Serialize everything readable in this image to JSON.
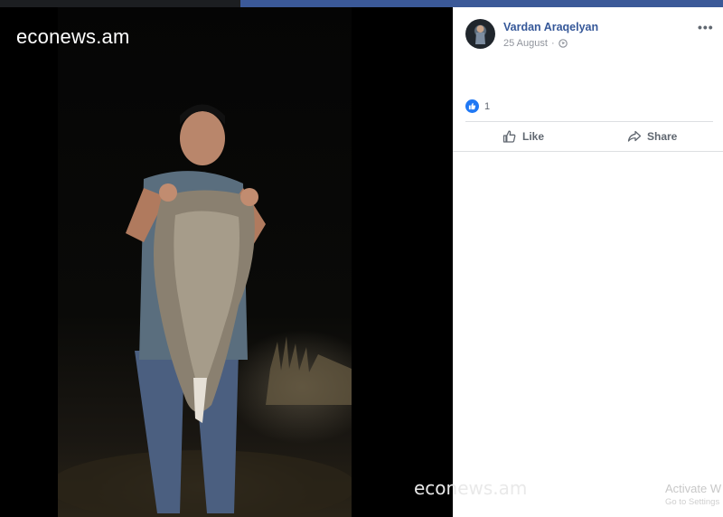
{
  "viewer": {
    "watermark_top": "econews.am",
    "watermark_bottom": "econews.am"
  },
  "post": {
    "author": "Vardan Araqelyan",
    "date": "25 August",
    "date_separator": "·",
    "reaction_count": "1",
    "actions": {
      "like_label": "Like",
      "share_label": "Share"
    }
  },
  "os_overlay": {
    "line1": "Activate W",
    "line2": "Go to Settings"
  },
  "colors": {
    "author_link": "#365899",
    "like_blue": "#2078f4",
    "header_blue": "#3b5998"
  }
}
